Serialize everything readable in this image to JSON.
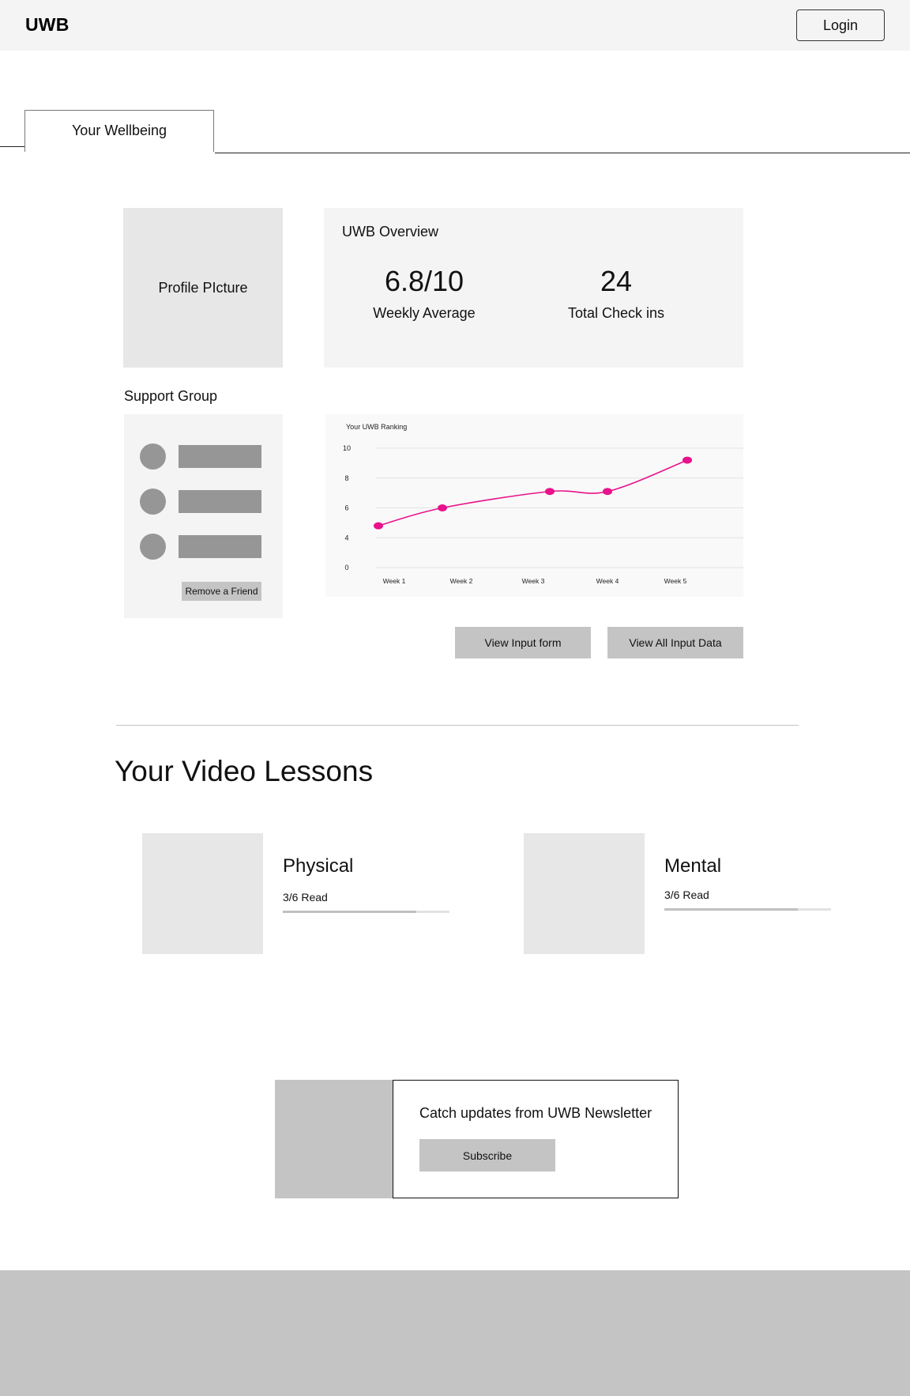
{
  "header": {
    "logo": "UWB",
    "login_label": "Login"
  },
  "tabs": [
    {
      "label": "Your Wellbeing",
      "active": true
    }
  ],
  "profile": {
    "placeholder_label": "Profile PIcture"
  },
  "overview": {
    "title": "UWB Overview",
    "stats": [
      {
        "value": "6.8/10",
        "label": "Weekly Average"
      },
      {
        "value": "24",
        "label": "Total Check ins"
      }
    ]
  },
  "support_group": {
    "title": "Support Group",
    "friends": [
      {
        "name": ""
      },
      {
        "name": ""
      },
      {
        "name": ""
      }
    ],
    "remove_label": "Remove a Friend"
  },
  "chart_data": {
    "type": "line",
    "title": "Your UWB Ranking",
    "xlabel": "",
    "ylabel": "",
    "categories": [
      "Week 1",
      "Week 2",
      "Week 3",
      "Week 4",
      "Week 5"
    ],
    "series": [
      {
        "name": "UWB Ranking",
        "values": [
          4.8,
          6.0,
          7.1,
          7.1,
          9.2
        ],
        "color": "#E8128C"
      }
    ],
    "y_tick_labels": [
      "0",
      "4",
      "6",
      "8",
      "10"
    ],
    "y_ticks": [
      0,
      4,
      6,
      8,
      10
    ],
    "smooth": true,
    "grid": true,
    "legend": "none"
  },
  "actions": {
    "view_input_form": "View Input form",
    "view_all_input_data": "View All Input Data"
  },
  "video_lessons": {
    "title": "Your Video Lessons",
    "lessons": [
      {
        "title": "Physical",
        "progress_label": "3/6 Read",
        "progress_fill": 0.8
      },
      {
        "title": "Mental",
        "progress_label": "3/6 Read",
        "progress_fill": 0.8
      }
    ]
  },
  "newsletter": {
    "text": "Catch updates from UWB Newsletter",
    "subscribe_label": "Subscribe"
  },
  "colors": {
    "accent": "#E8128C",
    "header_bg": "#F4F4F4",
    "placeholder_gray": "#C4C4C4",
    "avatar_gray": "#969696"
  }
}
